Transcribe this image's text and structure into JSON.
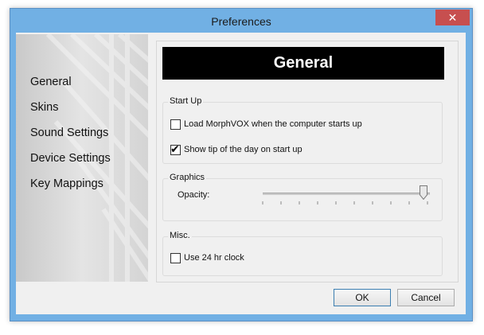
{
  "window": {
    "title": "Preferences",
    "close_glyph": "✕"
  },
  "sidebar": {
    "items": [
      {
        "label": "General"
      },
      {
        "label": "Skins"
      },
      {
        "label": "Sound Settings"
      },
      {
        "label": "Device Settings"
      },
      {
        "label": "Key Mappings"
      }
    ]
  },
  "panel": {
    "header": "General",
    "startup": {
      "label": "Start Up",
      "load_on_start": {
        "label": "Load MorphVOX when the computer starts up",
        "checked": false
      },
      "show_tip": {
        "label": "Show tip of the day on start up",
        "checked": true
      }
    },
    "graphics": {
      "label": "Graphics",
      "opacity_label": "Opacity:",
      "opacity_value": 1.0
    },
    "misc": {
      "label": "Misc.",
      "clock24": {
        "label": "Use 24 hr clock",
        "checked": false
      }
    }
  },
  "buttons": {
    "ok": "OK",
    "cancel": "Cancel"
  },
  "colors": {
    "frame": "#71b0e4",
    "close": "#c74f4f",
    "header_bg": "#000000"
  }
}
